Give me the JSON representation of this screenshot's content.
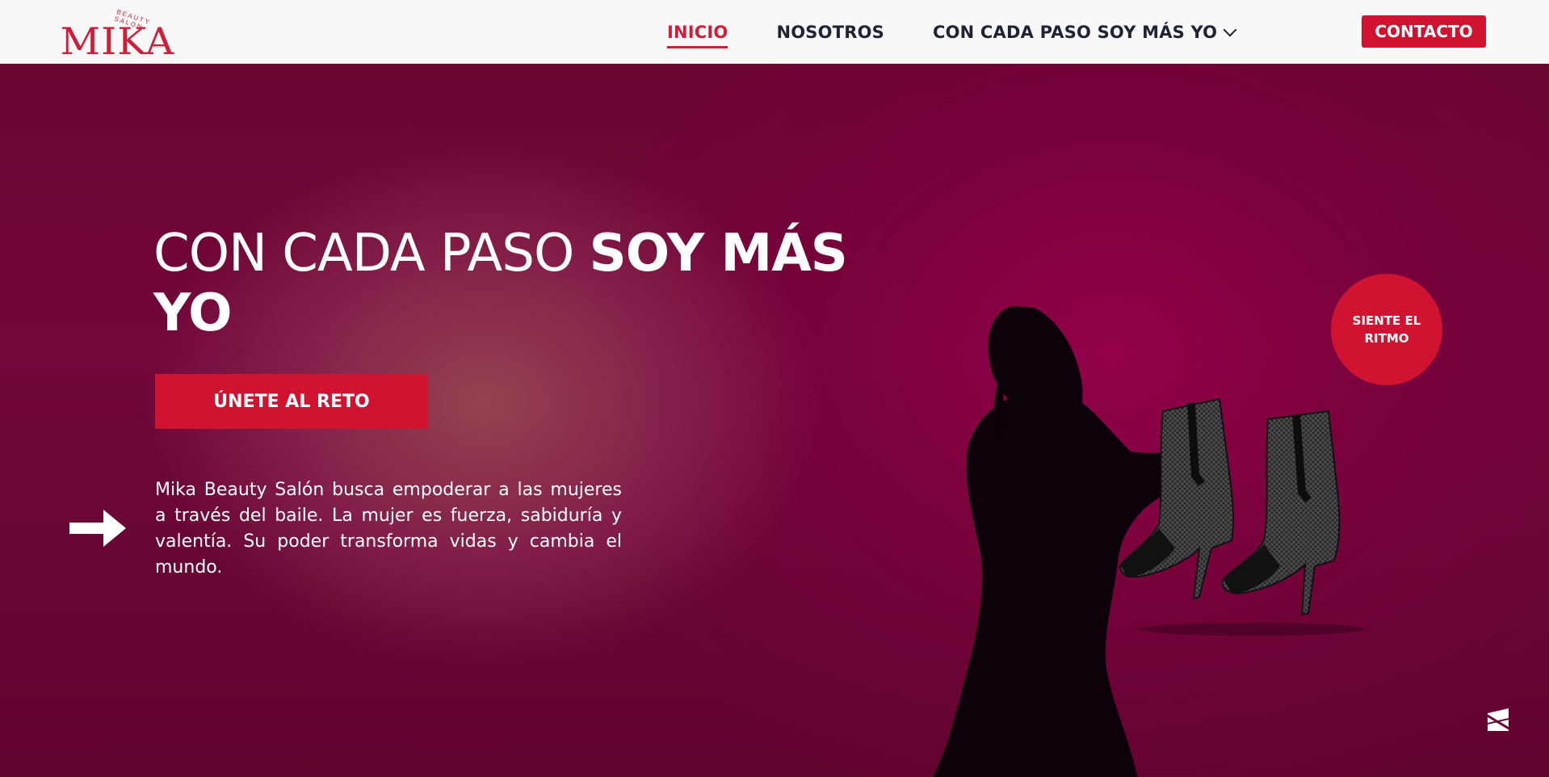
{
  "header": {
    "logo_text": "MIKA",
    "logo_sub": "BEAUTY SALON",
    "nav": [
      {
        "label": "INICIO",
        "active": true
      },
      {
        "label": "NOSOTROS",
        "active": false
      },
      {
        "label": "CON CADA PASO SOY MÁS YO",
        "active": false
      }
    ],
    "contact_label": "CONTACTO"
  },
  "hero": {
    "title_light": "CON CADA PASO ",
    "title_bold": "SOY MÁS YO",
    "cta_label": "ÚNETE AL RETO",
    "description": "Mika Beauty Salón busca empoderar a las mujeres a través del baile. La mujer es fuerza, sabiduría y valentía. Su poder transforma vidas y cambia el mundo.",
    "badge_line1": "SIENTE EL",
    "badge_line2": "RITMO"
  },
  "colors": {
    "brand_red": "#cf1330",
    "nav_text": "#1e2433",
    "hero_bg": "#6a0530"
  },
  "icons": [
    "chevron-down-icon",
    "arrow-right-icon",
    "corner-widget-icon"
  ]
}
